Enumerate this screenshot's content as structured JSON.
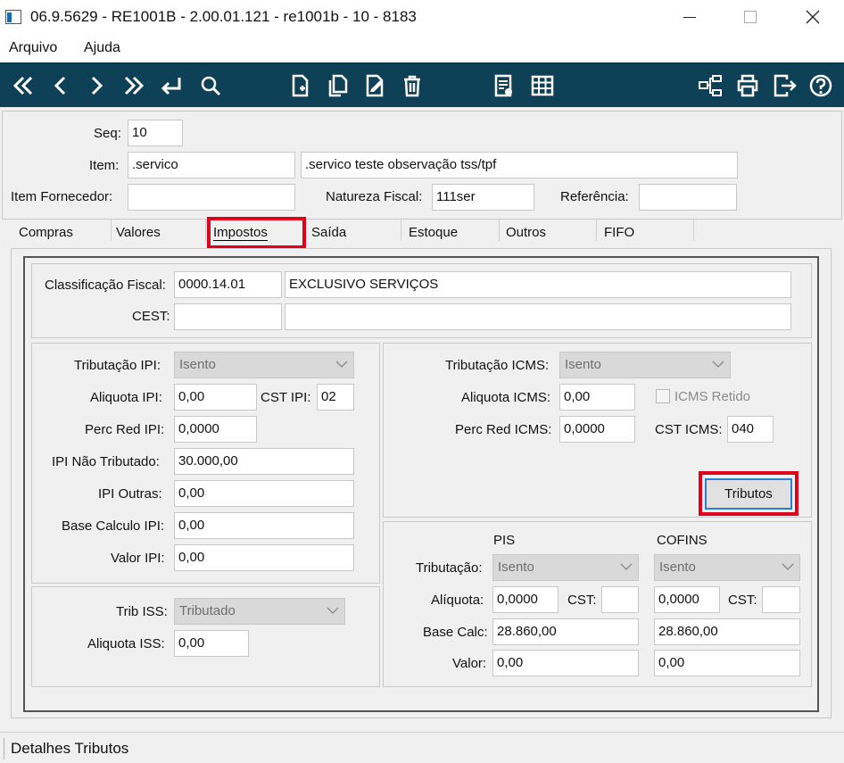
{
  "window": {
    "title": "06.9.5629 - RE1001B - 2.00.01.121 - re1001b - 10 - 8183"
  },
  "menu": {
    "arquivo": "Arquivo",
    "ajuda": "Ajuda"
  },
  "toolbar": {
    "icons": [
      "first-icon",
      "prev-icon",
      "next-icon",
      "last-icon",
      "enter-icon",
      "search-icon",
      "new-doc-icon",
      "copy-icon",
      "edit-icon",
      "delete-icon",
      "list-icon",
      "grid-icon",
      "tree-icon",
      "print-icon",
      "exit-icon",
      "help-icon"
    ]
  },
  "header": {
    "seq_label": "Seq:",
    "seq_value": "10",
    "item_label": "Item:",
    "item_value": ".servico",
    "item_desc": ".servico teste observação tss/tpf",
    "item_fornecedor_label": "Item Fornecedor:",
    "item_fornecedor_value": "",
    "natureza_label": "Natureza Fiscal:",
    "natureza_value": "111ser",
    "referencia_label": "Referência:",
    "referencia_value": ""
  },
  "tabs": [
    {
      "label": "Compras"
    },
    {
      "label": "Valores"
    },
    {
      "label": "Impostos",
      "active": true
    },
    {
      "label": "Saída"
    },
    {
      "label": "Estoque"
    },
    {
      "label": "Outros"
    },
    {
      "label": "FIFO"
    }
  ],
  "classificacao": {
    "label": "Classificação Fiscal:",
    "code": "0000.14.01",
    "desc": "EXCLUSIVO SERVIÇOS",
    "cest_label": "CEST:",
    "cest_value": "",
    "cest_desc": ""
  },
  "ipi": {
    "trib_label": "Tributação IPI:",
    "trib_value": "Isento",
    "aliq_label": "Aliquota IPI:",
    "aliq_value": "0,00",
    "cst_label": "CST IPI:",
    "cst_value": "02",
    "perc_label": "Perc Red IPI:",
    "perc_value": "0,0000",
    "nao_trib_label": "IPI Não Tributado:",
    "nao_trib_value": "30.000,00",
    "outras_label": "IPI Outras:",
    "outras_value": "0,00",
    "base_label": "Base Calculo IPI:",
    "base_value": "0,00",
    "valor_label": "Valor IPI:",
    "valor_value": "0,00"
  },
  "iss": {
    "trib_label": "Trib ISS:",
    "trib_value": "Tributado",
    "aliq_label": "Aliquota ISS:",
    "aliq_value": "0,00"
  },
  "icms": {
    "trib_label": "Tributação ICMS:",
    "trib_value": "Isento",
    "aliq_label": "Aliquota ICMS:",
    "aliq_value": "0,00",
    "retido_label": "ICMS Retido",
    "perc_label": "Perc Red ICMS:",
    "perc_value": "0,0000",
    "cst_label": "CST ICMS:",
    "cst_value": "040",
    "tributos_button": "Tributos"
  },
  "pis_cofins": {
    "pis_header": "PIS",
    "cofins_header": "COFINS",
    "trib_label": "Tributação:",
    "aliq_label": "Alíquota:",
    "cst_label": "CST:",
    "base_label": "Base Calc:",
    "valor_label": "Valor:",
    "pis_trib": "Isento",
    "pis_aliq": "0,0000",
    "pis_cst": "",
    "pis_base": "28.860,00",
    "pis_valor": "0,00",
    "cofins_trib": "Isento",
    "cofins_aliq": "0,0000",
    "cofins_cst": "",
    "cofins_base": "28.860,00",
    "cofins_valor": "0,00"
  },
  "status": {
    "text": "Detalhes Tributos"
  },
  "colors": {
    "toolbar_bg": "#0e4158",
    "highlight_red": "#e0001b",
    "button_focus": "#2a7fd4"
  }
}
